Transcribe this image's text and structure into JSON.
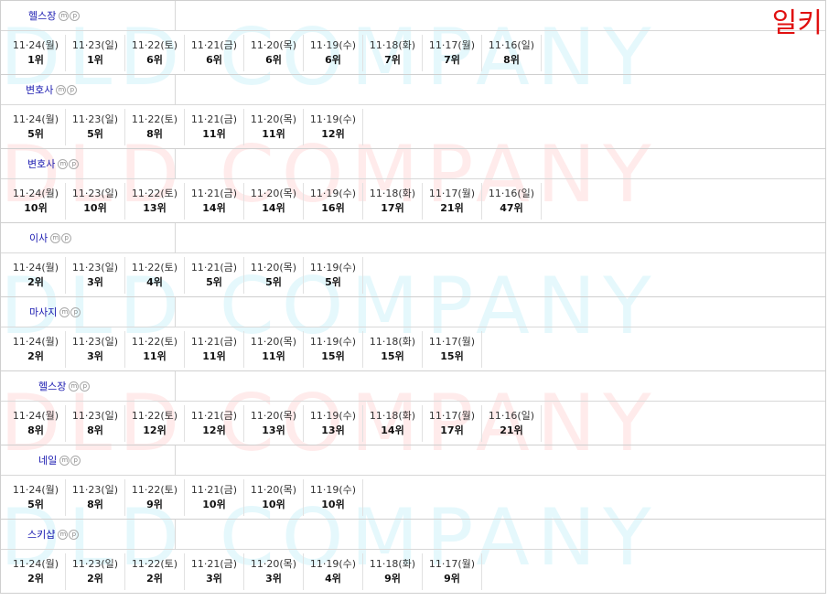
{
  "corner_label": "일키",
  "watermark": "DLD COMPANY",
  "blocks": [
    {
      "keyword": "헬스장",
      "indent": 30,
      "entries": [
        {
          "date": "11·24(월)",
          "rank": "1위"
        },
        {
          "date": "11·23(일)",
          "rank": "1위"
        },
        {
          "date": "11·22(토)",
          "rank": "6위"
        },
        {
          "date": "11·21(금)",
          "rank": "6위"
        },
        {
          "date": "11·20(목)",
          "rank": "6위"
        },
        {
          "date": "11·19(수)",
          "rank": "6위"
        },
        {
          "date": "11·18(화)",
          "rank": "7위"
        },
        {
          "date": "11·17(월)",
          "rank": "7위"
        },
        {
          "date": "11·16(일)",
          "rank": "8위"
        }
      ]
    },
    {
      "keyword": "변호사",
      "indent": 27,
      "entries": [
        {
          "date": "11·24(월)",
          "rank": "5위"
        },
        {
          "date": "11·23(일)",
          "rank": "5위"
        },
        {
          "date": "11·22(토)",
          "rank": "8위"
        },
        {
          "date": "11·21(금)",
          "rank": "11위"
        },
        {
          "date": "11·20(목)",
          "rank": "11위"
        },
        {
          "date": "11·19(수)",
          "rank": "12위"
        }
      ]
    },
    {
      "keyword": "변호사",
      "indent": 29,
      "entries": [
        {
          "date": "11·24(월)",
          "rank": "10위"
        },
        {
          "date": "11·23(일)",
          "rank": "10위"
        },
        {
          "date": "11·22(토)",
          "rank": "13위"
        },
        {
          "date": "11·21(금)",
          "rank": "14위"
        },
        {
          "date": "11·20(목)",
          "rank": "14위"
        },
        {
          "date": "11·19(수)",
          "rank": "16위"
        },
        {
          "date": "11·18(화)",
          "rank": "17위"
        },
        {
          "date": "11·17(월)",
          "rank": "21위"
        },
        {
          "date": "11·16(일)",
          "rank": "47위"
        }
      ]
    },
    {
      "keyword": "이사",
      "indent": 31,
      "entries": [
        {
          "date": "11·24(월)",
          "rank": "2위"
        },
        {
          "date": "11·23(일)",
          "rank": "3위"
        },
        {
          "date": "11·22(토)",
          "rank": "4위"
        },
        {
          "date": "11·21(금)",
          "rank": "5위"
        },
        {
          "date": "11·20(목)",
          "rank": "5위"
        },
        {
          "date": "11·19(수)",
          "rank": "5위"
        }
      ]
    },
    {
      "keyword": "마사지",
      "indent": 31,
      "entries": [
        {
          "date": "11·24(월)",
          "rank": "2위"
        },
        {
          "date": "11·23(일)",
          "rank": "3위"
        },
        {
          "date": "11·22(토)",
          "rank": "11위"
        },
        {
          "date": "11·21(금)",
          "rank": "11위"
        },
        {
          "date": "11·20(목)",
          "rank": "11위"
        },
        {
          "date": "11·19(수)",
          "rank": "15위"
        },
        {
          "date": "11·18(화)",
          "rank": "15위"
        },
        {
          "date": "11·17(월)",
          "rank": "15위"
        }
      ]
    },
    {
      "keyword": "헬스장",
      "indent": 41,
      "entries": [
        {
          "date": "11·24(월)",
          "rank": "8위"
        },
        {
          "date": "11·23(일)",
          "rank": "8위"
        },
        {
          "date": "11·22(토)",
          "rank": "12위"
        },
        {
          "date": "11·21(금)",
          "rank": "12위"
        },
        {
          "date": "11·20(목)",
          "rank": "13위"
        },
        {
          "date": "11·19(수)",
          "rank": "13위"
        },
        {
          "date": "11·18(화)",
          "rank": "14위"
        },
        {
          "date": "11·17(월)",
          "rank": "17위"
        },
        {
          "date": "11·16(일)",
          "rank": "21위"
        }
      ]
    },
    {
      "keyword": "네일",
      "indent": 41,
      "entries": [
        {
          "date": "11·24(월)",
          "rank": "5위"
        },
        {
          "date": "11·23(일)",
          "rank": "8위"
        },
        {
          "date": "11·22(토)",
          "rank": "9위"
        },
        {
          "date": "11·21(금)",
          "rank": "10위"
        },
        {
          "date": "11·20(목)",
          "rank": "10위"
        },
        {
          "date": "11·19(수)",
          "rank": "10위"
        }
      ]
    },
    {
      "keyword": "스키샵",
      "indent": 29,
      "entries": [
        {
          "date": "11·24(월)",
          "rank": "2위"
        },
        {
          "date": "11·23(일)",
          "rank": "2위"
        },
        {
          "date": "11·22(토)",
          "rank": "2위"
        },
        {
          "date": "11·21(금)",
          "rank": "3위"
        },
        {
          "date": "11·20(목)",
          "rank": "3위"
        },
        {
          "date": "11·19(수)",
          "rank": "4위"
        },
        {
          "date": "11·18(화)",
          "rank": "9위"
        },
        {
          "date": "11·17(월)",
          "rank": "9위"
        }
      ]
    }
  ],
  "icon_letters": {
    "m": "m",
    "p": "p"
  }
}
